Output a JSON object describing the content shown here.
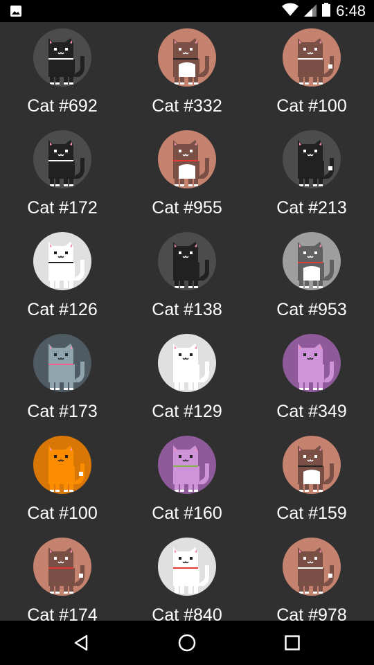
{
  "status_bar": {
    "time": "6:48",
    "icons": [
      "image-notification-icon",
      "wifi-icon",
      "cell-signal-icon",
      "battery-icon"
    ]
  },
  "cats": [
    {
      "label": "Cat #692",
      "bg": "#4c4c4c",
      "body": "#212121",
      "collar": "#ffffff",
      "bib": false,
      "tailTip": false
    },
    {
      "label": "Cat #332",
      "bg": "#c4826f",
      "body": "#7a5046",
      "collar": "#212121",
      "bib": true,
      "tailTip": false
    },
    {
      "label": "Cat #100",
      "bg": "#c4826f",
      "body": "#7a5046",
      "collar": "#ffffff",
      "bib": false,
      "tailTip": true
    },
    {
      "label": "Cat #172",
      "bg": "#4c4c4c",
      "body": "#212121",
      "collar": "#ffffff",
      "bib": false,
      "tailTip": false
    },
    {
      "label": "Cat #955",
      "bg": "#c4826f",
      "body": "#7a5046",
      "collar": "#e53935",
      "bib": true,
      "tailTip": false
    },
    {
      "label": "Cat #213",
      "bg": "#4c4c4c",
      "body": "#212121",
      "collar": "#212121",
      "bib": false,
      "tailTip": true
    },
    {
      "label": "Cat #126",
      "bg": "#e0e0e0",
      "body": "#ffffff",
      "collar": "#212121",
      "bib": false,
      "tailTip": false
    },
    {
      "label": "Cat #138",
      "bg": "#4c4c4c",
      "body": "#212121",
      "collar": "#212121",
      "bib": false,
      "tailTip": false
    },
    {
      "label": "Cat #953",
      "bg": "#9e9e9e",
      "body": "#616161",
      "collar": "#e53935",
      "bib": true,
      "tailTip": false
    },
    {
      "label": "Cat #173",
      "bg": "#4f5b62",
      "body": "#90a4ae",
      "collar": "#f06292",
      "bib": false,
      "tailTip": false
    },
    {
      "label": "Cat #129",
      "bg": "#e0e0e0",
      "body": "#ffffff",
      "collar": "#ffffff",
      "bib": false,
      "tailTip": false
    },
    {
      "label": "Cat #349",
      "bg": "#8e5a9a",
      "body": "#ce93d8",
      "collar": "#ce93d8",
      "bib": false,
      "tailTip": false
    },
    {
      "label": "Cat #100",
      "bg": "#d97706",
      "body": "#fb8c00",
      "collar": "#fb8c00",
      "bib": false,
      "tailTip": true
    },
    {
      "label": "Cat #160",
      "bg": "#8e5a9a",
      "body": "#ce93d8",
      "collar": "#7cb342",
      "bib": false,
      "tailTip": false
    },
    {
      "label": "Cat #159",
      "bg": "#c4826f",
      "body": "#7a5046",
      "collar": "#212121",
      "bib": true,
      "tailTip": false
    },
    {
      "label": "Cat #174",
      "bg": "#c4826f",
      "body": "#7a5046",
      "collar": "#e53935",
      "bib": false,
      "tailTip": true
    },
    {
      "label": "Cat #840",
      "bg": "#e0e0e0",
      "body": "#ffffff",
      "collar": "#e53935",
      "bib": false,
      "tailTip": false
    },
    {
      "label": "Cat #978",
      "bg": "#c4826f",
      "body": "#7a5046",
      "collar": "#ffffff",
      "bib": false,
      "tailTip": true
    }
  ],
  "nav_bar": {
    "buttons": [
      "back-icon",
      "home-icon",
      "recents-icon"
    ]
  }
}
